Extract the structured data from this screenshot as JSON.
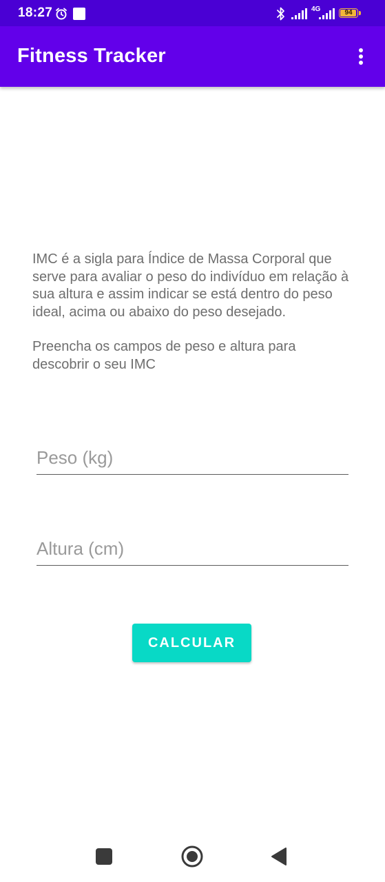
{
  "status_bar": {
    "time": "18:27",
    "network_label": "4G",
    "battery_level": "94",
    "battery_fraction": 0.94,
    "battery_color": "#f2b53b",
    "icons": [
      "alarm-icon",
      "square-notification-icon",
      "bluetooth-icon",
      "signal-icon",
      "signal-4g-icon",
      "battery-icon"
    ]
  },
  "app_bar": {
    "title": "Fitness Tracker",
    "menu_icon": "more-vert-icon",
    "color": "#6200ea"
  },
  "content": {
    "description": "IMC é a sigla para Índice de Massa Corporal que serve para avaliar o peso do indivíduo em relação à sua altura e assim indicar se está dentro do peso ideal, acima ou abaixo do peso desejado.",
    "instruction": "Preencha os campos de peso e altura para descobrir o seu IMC",
    "weight_field": {
      "value": "",
      "placeholder": "Peso (kg)"
    },
    "height_field": {
      "value": "",
      "placeholder": "Altura (cm)"
    },
    "calculate_button": {
      "label": "CALCULAR",
      "color": "#08d9c6"
    }
  },
  "nav_bar": {
    "icons": [
      "recents-icon",
      "home-icon",
      "back-icon"
    ]
  }
}
